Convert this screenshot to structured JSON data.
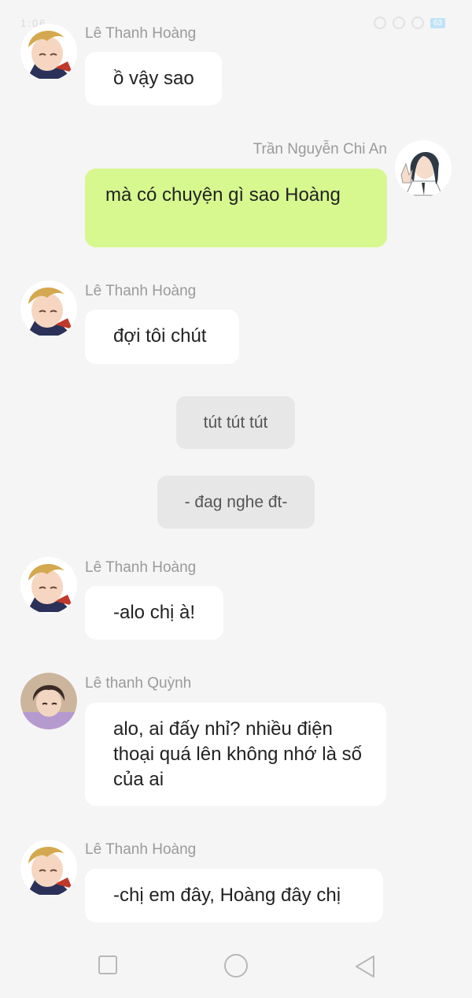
{
  "status_bar": {
    "left_text": "1:06",
    "battery": "63"
  },
  "messages": [
    {
      "type": "incoming",
      "sender": "Lê Thanh Hoàng",
      "text": "ồ vậy sao"
    },
    {
      "type": "outgoing",
      "sender": "Trần Nguyễn Chi An",
      "text": "mà có chuyện gì sao Hoàng"
    },
    {
      "type": "incoming",
      "sender": "Lê Thanh Hoàng",
      "text": "đợi tôi chút"
    },
    {
      "type": "system",
      "text": "tút tút tút"
    },
    {
      "type": "system",
      "text": "- đag nghe đt-"
    },
    {
      "type": "incoming",
      "sender": "Lê Thanh Hoàng",
      "text": "-alo chị à!"
    },
    {
      "type": "incoming",
      "sender": "Lê thanh Quỳnh",
      "text": "alo, ai đấy nhỉ? nhiều điện thoại quá lên không nhớ là số của ai"
    },
    {
      "type": "incoming",
      "sender": "Lê Thanh Hoàng",
      "text": "-chị em đây, Hoàng đây chị"
    }
  ],
  "nav": {
    "recent_icon": "square-icon",
    "home_icon": "circle-icon",
    "back_icon": "triangle-back-icon"
  },
  "colors": {
    "outgoing_bubble": "#d6f88f",
    "incoming_bubble": "#ffffff",
    "system_bubble": "#e7e7e7",
    "background": "#f5f5f5"
  }
}
